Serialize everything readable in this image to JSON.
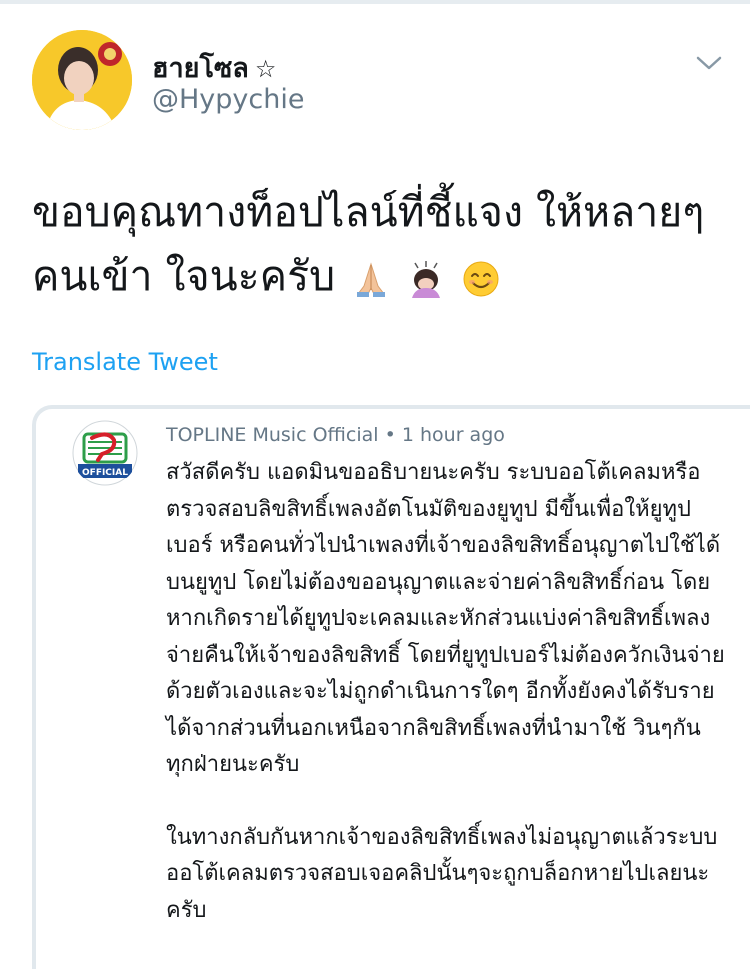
{
  "user": {
    "display_name": "ฮายโซล",
    "badge": "☆",
    "handle": "@Hypychie"
  },
  "tweet": {
    "text_line1": "ขอบคุณทางท็อปไลน์ที่ชี้แจง ให้หลายๆ",
    "text_line2": "คนเข้า ใจนะครับ",
    "emojis": [
      "folded-hands-emoji",
      "person-bowing-emoji",
      "smiling-face-emoji"
    ]
  },
  "translate_label": "Translate Tweet",
  "quote": {
    "channel_name": "TOPLINE Music Official",
    "separator": "•",
    "time": "1 hour ago",
    "paragraph1": "สวัสดีครับ แอดมินขออธิบายนะครับ ระบบออโต้เคลมหรือตรวจสอบลิขสิทธิ์เพลงอัตโนมัติของยูทูป มีขึ้นเพื่อให้ยูทูปเบอร์ หรือคนทั่วไปนำเพลงที่เจ้าของลิขสิทธิ์อนุญาตไปใช้ได้บนยูทูป โดยไม่ต้องขออนุญาตและจ่ายค่าลิขสิทธิ์ก่อน โดยหากเกิดรายได้ยูทูปจะเคลมและหักส่วนแบ่งค่าลิขสิทธิ์เพลงจ่ายคืนให้เจ้าของลิขสิทธิ์ โดยที่ยูทูปเบอร์ไม่ต้องควักเงินจ่ายด้วยตัวเองและจะไม่ถูกดำเนินการใดๆ อีกทั้งยังคงได้รับรายได้จากส่วนที่นอกเหนือจากลิขสิทธิ์เพลงที่นำมาใช้ วินๆกันทุกฝ่ายนะครับ",
    "paragraph2": "ในทางกลับกันหากเจ้าของลิขสิทธิ์เพลงไม่อนุญาตแล้วระบบออโต้เคลมตรวจสอบเจอคลิปนั้นๆจะถูกบล็อกหายไปเลยนะครับ"
  },
  "colors": {
    "link": "#1da1f2",
    "secondary_text": "#657786",
    "avatar_bg": "#f7c82a",
    "logo_red": "#d6202a",
    "logo_green": "#2e9e4a"
  }
}
